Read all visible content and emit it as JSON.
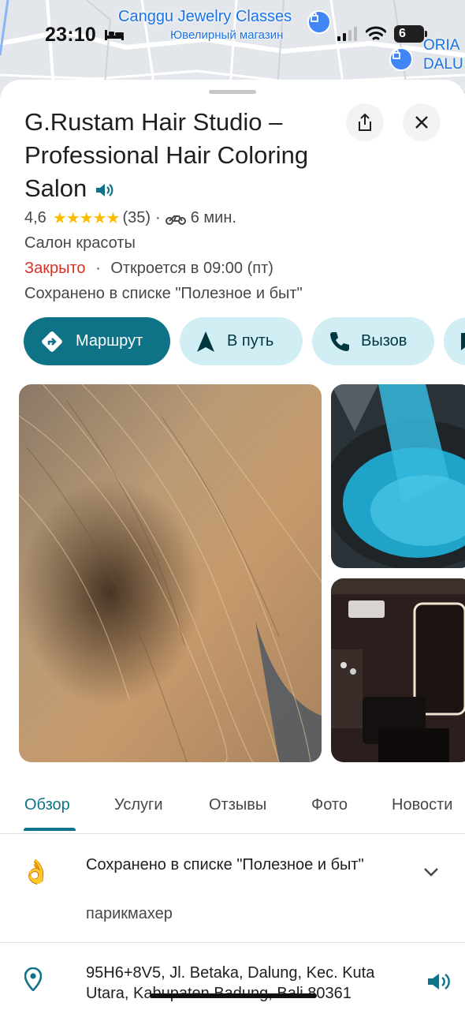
{
  "status_bar": {
    "time": "23:10",
    "battery": "6"
  },
  "map": {
    "label_1": "Canggu Jewelry Classes",
    "label_2": "Ювелирный магазин",
    "label_3_line1": "ORIA",
    "label_3_line2": "DALU"
  },
  "place": {
    "title": "G.Rustam Hair Studio – Professional Hair Coloring Salon",
    "rating": "4,6",
    "stars": "★★★★★",
    "reviews_count": "(35)",
    "separator": "·",
    "travel_time": "6 мин.",
    "category": "Салон красоты",
    "status_closed": "Закрыто",
    "status_dot": "·",
    "opens_at": "Откроется в 09:00 (пт)",
    "saved_in_list": "Сохранено в списке \"Полезное и быт\""
  },
  "actions": [
    {
      "label": "Маршрут",
      "icon": "directions-icon"
    },
    {
      "label": "В путь",
      "icon": "navigation-arrow-icon"
    },
    {
      "label": "Вызов",
      "icon": "phone-icon"
    }
  ],
  "tabs": [
    {
      "label": "Обзор",
      "active": true
    },
    {
      "label": "Услуги",
      "active": false
    },
    {
      "label": "Отзывы",
      "active": false
    },
    {
      "label": "Фото",
      "active": false
    },
    {
      "label": "Новости",
      "active": false
    }
  ],
  "details": {
    "saved_title": "Сохранено в списке \"Полезное и быт\"",
    "saved_subtitle": "парикмахер",
    "saved_emoji": "👌",
    "address": "95H6+8V5, Jl. Betaka, Dalung, Kec. Kuta Utara, Kabupaten Badung, Bali 80361"
  },
  "colors": {
    "accent": "#0e7386",
    "chip_secondary": "#d2eef5",
    "closed": "#d93025",
    "star": "#fbbc04"
  }
}
